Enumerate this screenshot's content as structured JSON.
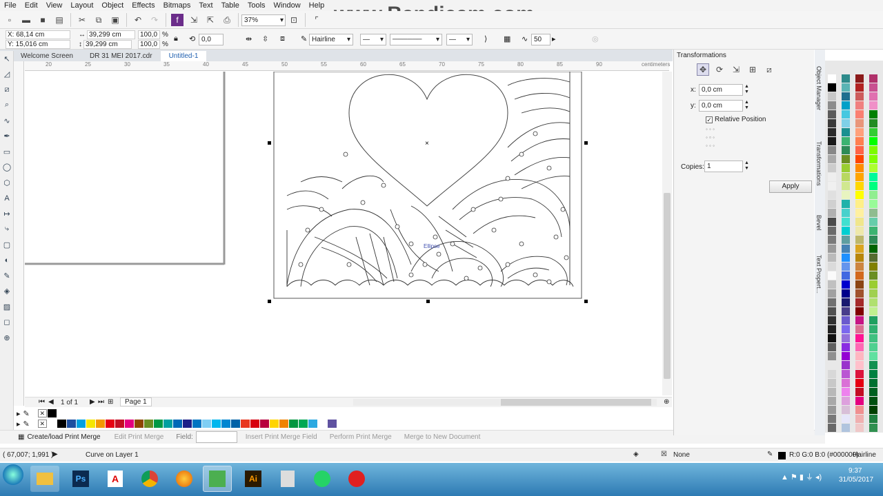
{
  "menu": [
    "File",
    "Edit",
    "View",
    "Layout",
    "Object",
    "Effects",
    "Bitmaps",
    "Text",
    "Table",
    "Tools",
    "Window",
    "Help"
  ],
  "watermark": "www.Bandicam.com",
  "toolbar": {
    "zoom": "37%"
  },
  "props": {
    "x": "X: 68,14 cm",
    "y": "Y: 15,016 cm",
    "w": "39,299 cm",
    "h": "39,299 cm",
    "sx": "100,0",
    "sy": "100,0",
    "pct1": "%",
    "pct2": "%",
    "angle": "0,0",
    "outline": "Hairline",
    "smooth": "50"
  },
  "tabs": [
    "Welcome Screen",
    "DR 31 MEI 2017.cdr",
    "Untitled-1"
  ],
  "ruler": {
    "ticks": [
      "20",
      "25",
      "30",
      "35",
      "40",
      "45",
      "50",
      "55",
      "60",
      "65",
      "70",
      "75",
      "80",
      "85",
      "90"
    ],
    "unit": "centimeters"
  },
  "page_nav": {
    "count": "1 of 1",
    "page": "Page 1"
  },
  "canvas_label": "Ellipse",
  "merge": [
    "Create/load Print Merge",
    "Edit Print Merge",
    "Field:",
    "Insert Print Merge Field",
    "Perform Print Merge",
    "Merge to New Document"
  ],
  "status": {
    "coords": "( 67,007; 1,991 )",
    "object": "Curve on Layer 1",
    "fill": "None",
    "outline_color": "R:0 G:0 B:0 (#000000)",
    "outline_width": "Hairline"
  },
  "docker": {
    "title": "Transformations",
    "x_label": "x:",
    "x_value": "0,0 cm",
    "y_label": "y:",
    "y_value": "0,0 cm",
    "relative": "Relative Position",
    "copies_label": "Copies:",
    "copies_value": "1",
    "apply": "Apply"
  },
  "docker_tabs": [
    "Object Manager",
    "Transformations",
    "Bevel",
    "Text Propert..."
  ],
  "taskbar": {
    "time": "9:37",
    "date": "31/05/2017"
  },
  "colors": {
    "bottom_palette": [
      "#ffffff",
      "#000000",
      "#1d4fa0",
      "#00a0e0",
      "#f5e600",
      "#f39800",
      "#e60012",
      "#c30d23",
      "#e4007f",
      "#8f4500",
      "#6b8e23",
      "#009944",
      "#00a0a0",
      "#0068b7",
      "#1d2088",
      "#0075c2",
      "#7fcef4",
      "#00b7ee",
      "#0086d1",
      "#0062a8",
      "#e83820",
      "#d7000f",
      "#b8003d",
      "#ffd400",
      "#f08300",
      "#00963f",
      "#00a854",
      "#2ca9e1",
      "#ffffff",
      "#5f52a0"
    ]
  }
}
